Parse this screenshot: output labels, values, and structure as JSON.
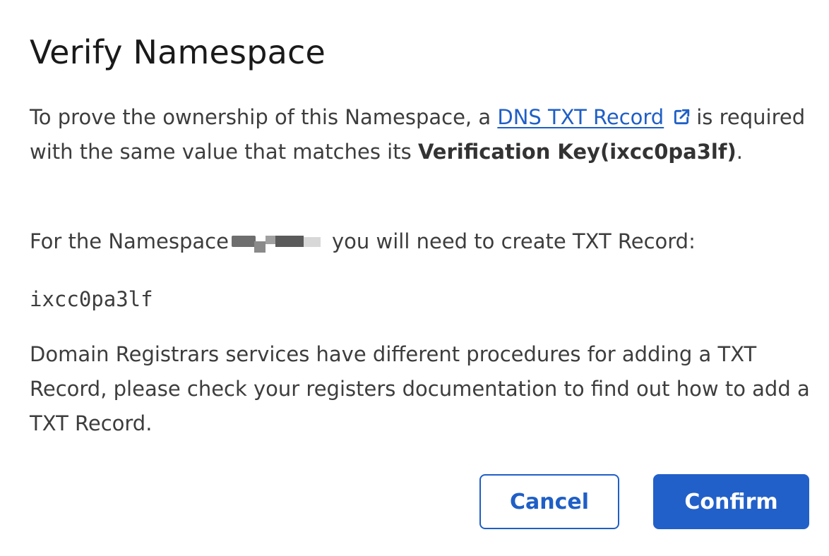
{
  "dialog": {
    "title": "Verify Namespace",
    "intro": {
      "text_before_link": "To prove the ownership of this Namespace, a ",
      "link_label": "DNS TXT Record",
      "link_icon": "external-link-icon",
      "text_after_link": "is required with the same value that matches its ",
      "bold_key": "Verification Key(ixcc0pa3lf)",
      "text_end": "."
    },
    "namespace_line": {
      "text_before": "For the Namespace",
      "text_after": "you will need to create TXT Record:"
    },
    "verification_value": "ixcc0pa3lf",
    "registrar_note": "Domain Registrars services have different procedures for adding a TXT Record, please check your registers documentation to find out how to add a TXT Record.",
    "buttons": {
      "cancel_label": "Cancel",
      "confirm_label": "Confirm"
    }
  },
  "colors": {
    "accent": "#1f5fc6",
    "primary_button": "#2260c9",
    "text": "#3d3d3d",
    "title": "#1a1a1a"
  }
}
